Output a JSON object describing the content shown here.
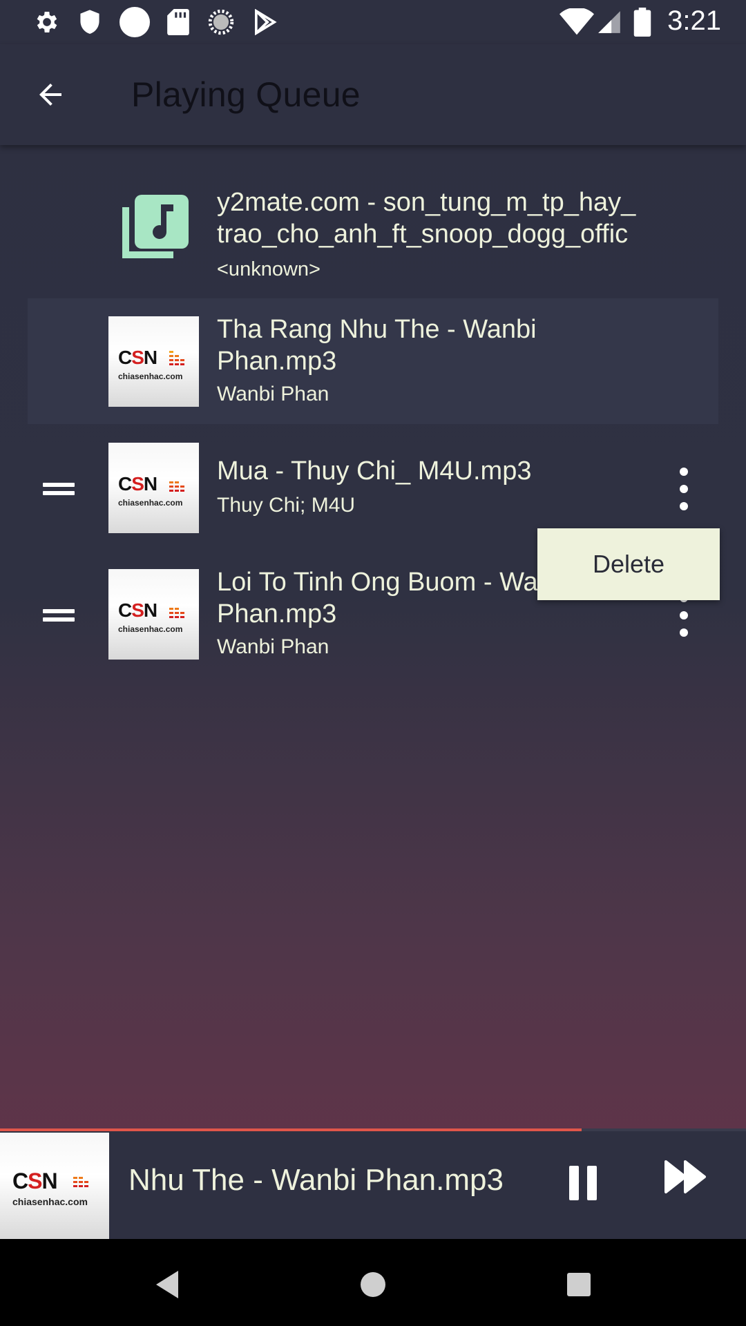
{
  "status_bar": {
    "time": "3:21",
    "left_icons": [
      "settings-icon",
      "shield-icon",
      "circle-icon",
      "sd-card-icon",
      "loading-icon",
      "play-store-icon"
    ],
    "right_icons": [
      "wifi-icon",
      "signal-icon",
      "battery-icon"
    ]
  },
  "app_bar": {
    "title": "Playing Queue"
  },
  "queue": [
    {
      "title": "y2mate.com - son_tung_m_tp_hay_trao_cho_anh_ft_snoop_dogg_offic",
      "title_lines": [
        "y2mate.com - son_tung_m_tp_hay_",
        "trao_cho_anh_ft_snoop_dogg_offic"
      ],
      "artist": "<unknown>",
      "art": "music-library-icon"
    },
    {
      "title": "Tha Rang Nhu The - Wanbi Phan.mp3",
      "title_lines": [
        "Tha Rang Nhu The - Wanbi",
        "Phan.mp3"
      ],
      "artist": "Wanbi Phan",
      "art": "chiasenhac-album-art",
      "current": true
    },
    {
      "title": "Mua - Thuy Chi_ M4U.mp3",
      "title_lines": [
        "Mua - Thuy Chi_ M4U.mp3"
      ],
      "artist": "Thuy Chi; M4U",
      "art": "chiasenhac-album-art"
    },
    {
      "title": "Loi To Tinh Ong Buom - Wa…",
      "title_lines": [
        "Loi To Tinh Ong Buom - Wa",
        "Phan.mp3"
      ],
      "artist": "Wanbi Phan",
      "art": "chiasenhac-album-art"
    }
  ],
  "album_art_text": {
    "logo": "CSN",
    "site": "chiasenhac.com"
  },
  "popup_menu": {
    "items": [
      "Delete"
    ]
  },
  "mini_player": {
    "title": "Nhu The - Wanbi Phan.mp3",
    "progress": 0.78,
    "progress_color": "#e0564a"
  },
  "nav_bar": {
    "buttons": [
      "back-icon",
      "home-icon",
      "recents-icon"
    ]
  }
}
